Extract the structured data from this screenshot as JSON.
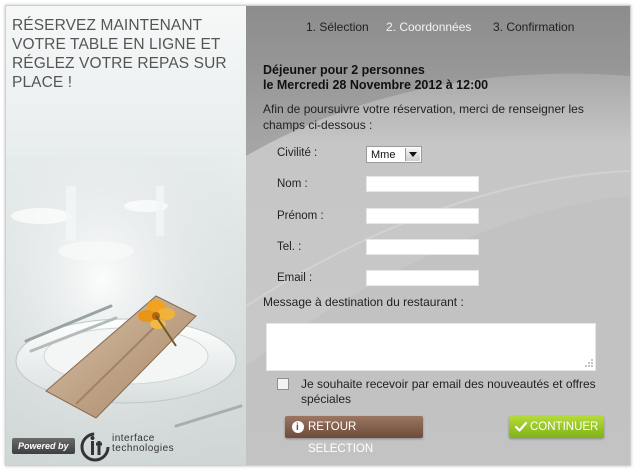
{
  "promo": {
    "lines": [
      "RÉSERVEZ MAINTENANT",
      "VOTRE TABLE EN LIGNE ET",
      "RÉGLEZ VOTRE REPAS SUR",
      "PLACE !"
    ]
  },
  "footer": {
    "powered_label": "Powered by",
    "brand_line1": "interface",
    "brand_line2": "technologies"
  },
  "steps": [
    {
      "label": "1. Sélection",
      "state": "done"
    },
    {
      "label": "2. Coordonnées",
      "state": "active"
    },
    {
      "label": "3. Confirmation",
      "state": "upcoming"
    }
  ],
  "booking": {
    "line1": "Déjeuner pour 2 personnes",
    "line2": "le Mercredi 28 Novembre 2012 à 12:00"
  },
  "intro": "Afin de poursuivre votre réservation, merci de renseigner les champs ci-dessous :",
  "form": {
    "civilite_label": "Civilité :",
    "civilite_value": "Mme",
    "nom_label": "Nom :",
    "nom_value": "",
    "prenom_label": "Prénom :",
    "prenom_value": "",
    "tel_label": "Tel. :",
    "tel_value": "",
    "email_label": "Email :",
    "email_value": "",
    "message_label": "Message à destination du restaurant :",
    "message_value": "",
    "newsletter_label": "Je souhaite recevoir par email des nouveautés et offres spéciales",
    "newsletter_checked": false
  },
  "actions": {
    "back_label": "RETOUR SELECTION",
    "continue_label": "CONTINUER"
  },
  "colors": {
    "panel_gray": "#c9c9c9",
    "step_active": "#f3f3f3",
    "back_button": "#7b5744",
    "continue_button": "#8dc21f"
  },
  "icons": {
    "back": "info-icon",
    "continue": "checkmark-icon",
    "select": "dropdown-arrow-icon"
  }
}
